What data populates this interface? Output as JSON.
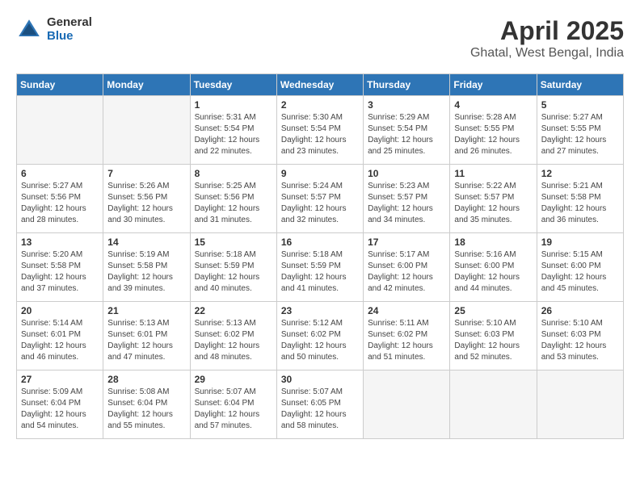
{
  "logo": {
    "general": "General",
    "blue": "Blue"
  },
  "title": {
    "month": "April 2025",
    "location": "Ghatal, West Bengal, India"
  },
  "headers": [
    "Sunday",
    "Monday",
    "Tuesday",
    "Wednesday",
    "Thursday",
    "Friday",
    "Saturday"
  ],
  "weeks": [
    [
      {
        "day": "",
        "info": ""
      },
      {
        "day": "",
        "info": ""
      },
      {
        "day": "1",
        "info": "Sunrise: 5:31 AM\nSunset: 5:54 PM\nDaylight: 12 hours and 22 minutes."
      },
      {
        "day": "2",
        "info": "Sunrise: 5:30 AM\nSunset: 5:54 PM\nDaylight: 12 hours and 23 minutes."
      },
      {
        "day": "3",
        "info": "Sunrise: 5:29 AM\nSunset: 5:54 PM\nDaylight: 12 hours and 25 minutes."
      },
      {
        "day": "4",
        "info": "Sunrise: 5:28 AM\nSunset: 5:55 PM\nDaylight: 12 hours and 26 minutes."
      },
      {
        "day": "5",
        "info": "Sunrise: 5:27 AM\nSunset: 5:55 PM\nDaylight: 12 hours and 27 minutes."
      }
    ],
    [
      {
        "day": "6",
        "info": "Sunrise: 5:27 AM\nSunset: 5:56 PM\nDaylight: 12 hours and 28 minutes."
      },
      {
        "day": "7",
        "info": "Sunrise: 5:26 AM\nSunset: 5:56 PM\nDaylight: 12 hours and 30 minutes."
      },
      {
        "day": "8",
        "info": "Sunrise: 5:25 AM\nSunset: 5:56 PM\nDaylight: 12 hours and 31 minutes."
      },
      {
        "day": "9",
        "info": "Sunrise: 5:24 AM\nSunset: 5:57 PM\nDaylight: 12 hours and 32 minutes."
      },
      {
        "day": "10",
        "info": "Sunrise: 5:23 AM\nSunset: 5:57 PM\nDaylight: 12 hours and 34 minutes."
      },
      {
        "day": "11",
        "info": "Sunrise: 5:22 AM\nSunset: 5:57 PM\nDaylight: 12 hours and 35 minutes."
      },
      {
        "day": "12",
        "info": "Sunrise: 5:21 AM\nSunset: 5:58 PM\nDaylight: 12 hours and 36 minutes."
      }
    ],
    [
      {
        "day": "13",
        "info": "Sunrise: 5:20 AM\nSunset: 5:58 PM\nDaylight: 12 hours and 37 minutes."
      },
      {
        "day": "14",
        "info": "Sunrise: 5:19 AM\nSunset: 5:58 PM\nDaylight: 12 hours and 39 minutes."
      },
      {
        "day": "15",
        "info": "Sunrise: 5:18 AM\nSunset: 5:59 PM\nDaylight: 12 hours and 40 minutes."
      },
      {
        "day": "16",
        "info": "Sunrise: 5:18 AM\nSunset: 5:59 PM\nDaylight: 12 hours and 41 minutes."
      },
      {
        "day": "17",
        "info": "Sunrise: 5:17 AM\nSunset: 6:00 PM\nDaylight: 12 hours and 42 minutes."
      },
      {
        "day": "18",
        "info": "Sunrise: 5:16 AM\nSunset: 6:00 PM\nDaylight: 12 hours and 44 minutes."
      },
      {
        "day": "19",
        "info": "Sunrise: 5:15 AM\nSunset: 6:00 PM\nDaylight: 12 hours and 45 minutes."
      }
    ],
    [
      {
        "day": "20",
        "info": "Sunrise: 5:14 AM\nSunset: 6:01 PM\nDaylight: 12 hours and 46 minutes."
      },
      {
        "day": "21",
        "info": "Sunrise: 5:13 AM\nSunset: 6:01 PM\nDaylight: 12 hours and 47 minutes."
      },
      {
        "day": "22",
        "info": "Sunrise: 5:13 AM\nSunset: 6:02 PM\nDaylight: 12 hours and 48 minutes."
      },
      {
        "day": "23",
        "info": "Sunrise: 5:12 AM\nSunset: 6:02 PM\nDaylight: 12 hours and 50 minutes."
      },
      {
        "day": "24",
        "info": "Sunrise: 5:11 AM\nSunset: 6:02 PM\nDaylight: 12 hours and 51 minutes."
      },
      {
        "day": "25",
        "info": "Sunrise: 5:10 AM\nSunset: 6:03 PM\nDaylight: 12 hours and 52 minutes."
      },
      {
        "day": "26",
        "info": "Sunrise: 5:10 AM\nSunset: 6:03 PM\nDaylight: 12 hours and 53 minutes."
      }
    ],
    [
      {
        "day": "27",
        "info": "Sunrise: 5:09 AM\nSunset: 6:04 PM\nDaylight: 12 hours and 54 minutes."
      },
      {
        "day": "28",
        "info": "Sunrise: 5:08 AM\nSunset: 6:04 PM\nDaylight: 12 hours and 55 minutes."
      },
      {
        "day": "29",
        "info": "Sunrise: 5:07 AM\nSunset: 6:04 PM\nDaylight: 12 hours and 57 minutes."
      },
      {
        "day": "30",
        "info": "Sunrise: 5:07 AM\nSunset: 6:05 PM\nDaylight: 12 hours and 58 minutes."
      },
      {
        "day": "",
        "info": ""
      },
      {
        "day": "",
        "info": ""
      },
      {
        "day": "",
        "info": ""
      }
    ]
  ]
}
